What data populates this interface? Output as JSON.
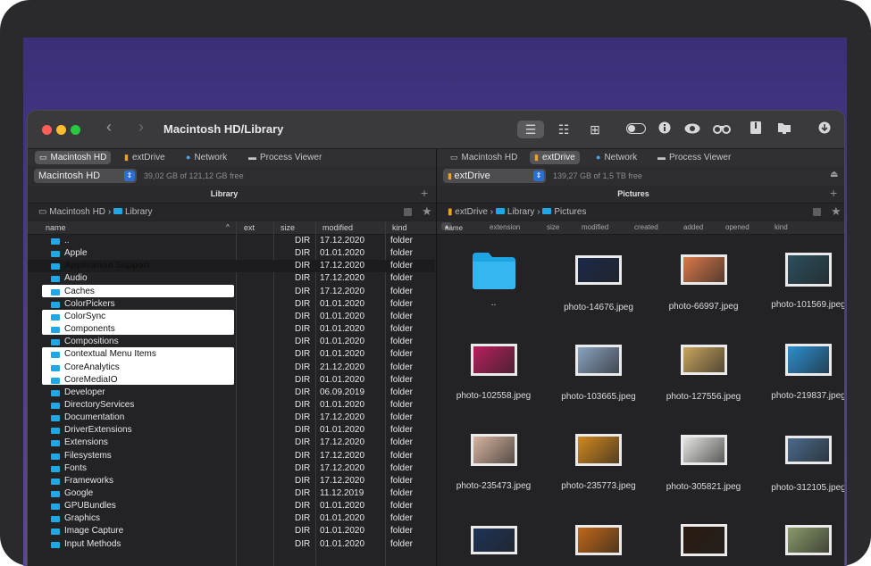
{
  "window": {
    "title": "Macintosh HD/Library",
    "back": "‹",
    "forward": "›"
  },
  "toolbar": {
    "icons": [
      "list-view-icon",
      "detail-view-icon",
      "grid-view-icon",
      "toggle-icon",
      "info-icon",
      "eye-icon",
      "binoculars-icon",
      "archive-icon",
      "folder-icon",
      "download-icon"
    ]
  },
  "left": {
    "drives": [
      "Macintosh HD",
      "extDrive",
      "Network",
      "Process Viewer"
    ],
    "volume": "Macintosh HD",
    "free": "39,02 GB of 121,12 GB free",
    "header": "Library",
    "plus": "+",
    "path": [
      "Macintosh HD",
      "Library"
    ],
    "columns": {
      "name": "name",
      "ext": "ext",
      "size": "size",
      "modified": "modified",
      "kind": "kind"
    },
    "rows": [
      {
        "name": "..",
        "size": "DIR",
        "modified": "17.12.2020",
        "kind": "folder"
      },
      {
        "name": "Apple",
        "size": "DIR",
        "modified": "01.01.2020",
        "kind": "folder"
      },
      {
        "name": "Application Support",
        "size": "DIR",
        "modified": "17.12.2020",
        "kind": "folder"
      },
      {
        "name": "Audio",
        "size": "DIR",
        "modified": "17.12.2020",
        "kind": "folder"
      },
      {
        "name": "Caches",
        "size": "DIR",
        "modified": "17.12.2020",
        "kind": "folder"
      },
      {
        "name": "ColorPickers",
        "size": "DIR",
        "modified": "01.01.2020",
        "kind": "folder"
      },
      {
        "name": "ColorSync",
        "size": "DIR",
        "modified": "01.01.2020",
        "kind": "folder"
      },
      {
        "name": "Components",
        "size": "DIR",
        "modified": "01.01.2020",
        "kind": "folder"
      },
      {
        "name": "Compositions",
        "size": "DIR",
        "modified": "01.01.2020",
        "kind": "folder"
      },
      {
        "name": "Contextual Menu Items",
        "size": "DIR",
        "modified": "01.01.2020",
        "kind": "folder"
      },
      {
        "name": "CoreAnalytics",
        "size": "DIR",
        "modified": "21.12.2020",
        "kind": "folder"
      },
      {
        "name": "CoreMediaIO",
        "size": "DIR",
        "modified": "01.01.2020",
        "kind": "folder"
      },
      {
        "name": "Developer",
        "size": "DIR",
        "modified": "06.09.2019",
        "kind": "folder"
      },
      {
        "name": "DirectoryServices",
        "size": "DIR",
        "modified": "01.01.2020",
        "kind": "folder"
      },
      {
        "name": "Documentation",
        "size": "DIR",
        "modified": "17.12.2020",
        "kind": "folder"
      },
      {
        "name": "DriverExtensions",
        "size": "DIR",
        "modified": "01.01.2020",
        "kind": "folder"
      },
      {
        "name": "Extensions",
        "size": "DIR",
        "modified": "17.12.2020",
        "kind": "folder"
      },
      {
        "name": "Filesystems",
        "size": "DIR",
        "modified": "17.12.2020",
        "kind": "folder"
      },
      {
        "name": "Fonts",
        "size": "DIR",
        "modified": "17.12.2020",
        "kind": "folder"
      },
      {
        "name": "Frameworks",
        "size": "DIR",
        "modified": "17.12.2020",
        "kind": "folder"
      },
      {
        "name": "Google",
        "size": "DIR",
        "modified": "11.12.2019",
        "kind": "folder"
      },
      {
        "name": "GPUBundles",
        "size": "DIR",
        "modified": "01.01.2020",
        "kind": "folder"
      },
      {
        "name": "Graphics",
        "size": "DIR",
        "modified": "01.01.2020",
        "kind": "folder"
      },
      {
        "name": "Image Capture",
        "size": "DIR",
        "modified": "01.01.2020",
        "kind": "folder"
      },
      {
        "name": "Input Methods",
        "size": "DIR",
        "modified": "01.01.2020",
        "kind": "folder"
      }
    ]
  },
  "right": {
    "drives": [
      "Macintosh HD",
      "extDrive",
      "Network",
      "Process Viewer"
    ],
    "volume": "extDrive",
    "free": "139,27 GB of 1,5 TB free",
    "header": "Pictures",
    "plus": "+",
    "path": [
      "extDrive",
      "Library",
      "Pictures"
    ],
    "columns": {
      "name": "name",
      "extension": "extension",
      "size": "size",
      "modified": "modified",
      "created": "created",
      "added": "added",
      "opened": "opened",
      "kind": "kind"
    },
    "items": [
      {
        "label": "..",
        "thumb": "folder"
      },
      {
        "label": "photo-14676.jpeg",
        "thumb": "#1b2a4a"
      },
      {
        "label": "photo-66997.jpeg",
        "thumb": "#d9794a"
      },
      {
        "label": "photo-101569.jpeg",
        "thumb": "#2c4f5e"
      },
      {
        "label": "photo-102558.jpeg",
        "thumb": "#b8205e"
      },
      {
        "label": "photo-103665.jpeg",
        "thumb": "#8aa3c1"
      },
      {
        "label": "photo-127556.jpeg",
        "thumb": "#c9a45e"
      },
      {
        "label": "photo-219837.jpeg",
        "thumb": "#2a8fd0"
      },
      {
        "label": "photo-235473.jpeg",
        "thumb": "#d8b4a0"
      },
      {
        "label": "photo-235773.jpeg",
        "thumb": "#d0881e"
      },
      {
        "label": "photo-305821.jpeg",
        "thumb": "#e4e4e0"
      },
      {
        "label": "photo-312105.jpeg",
        "thumb": "#4a6a8c"
      },
      {
        "label": "",
        "thumb": "#1d3358"
      },
      {
        "label": "",
        "thumb": "#c06818"
      },
      {
        "label": "",
        "thumb": "#2a1a10"
      },
      {
        "label": "",
        "thumb": "#8a9a6a"
      }
    ]
  }
}
